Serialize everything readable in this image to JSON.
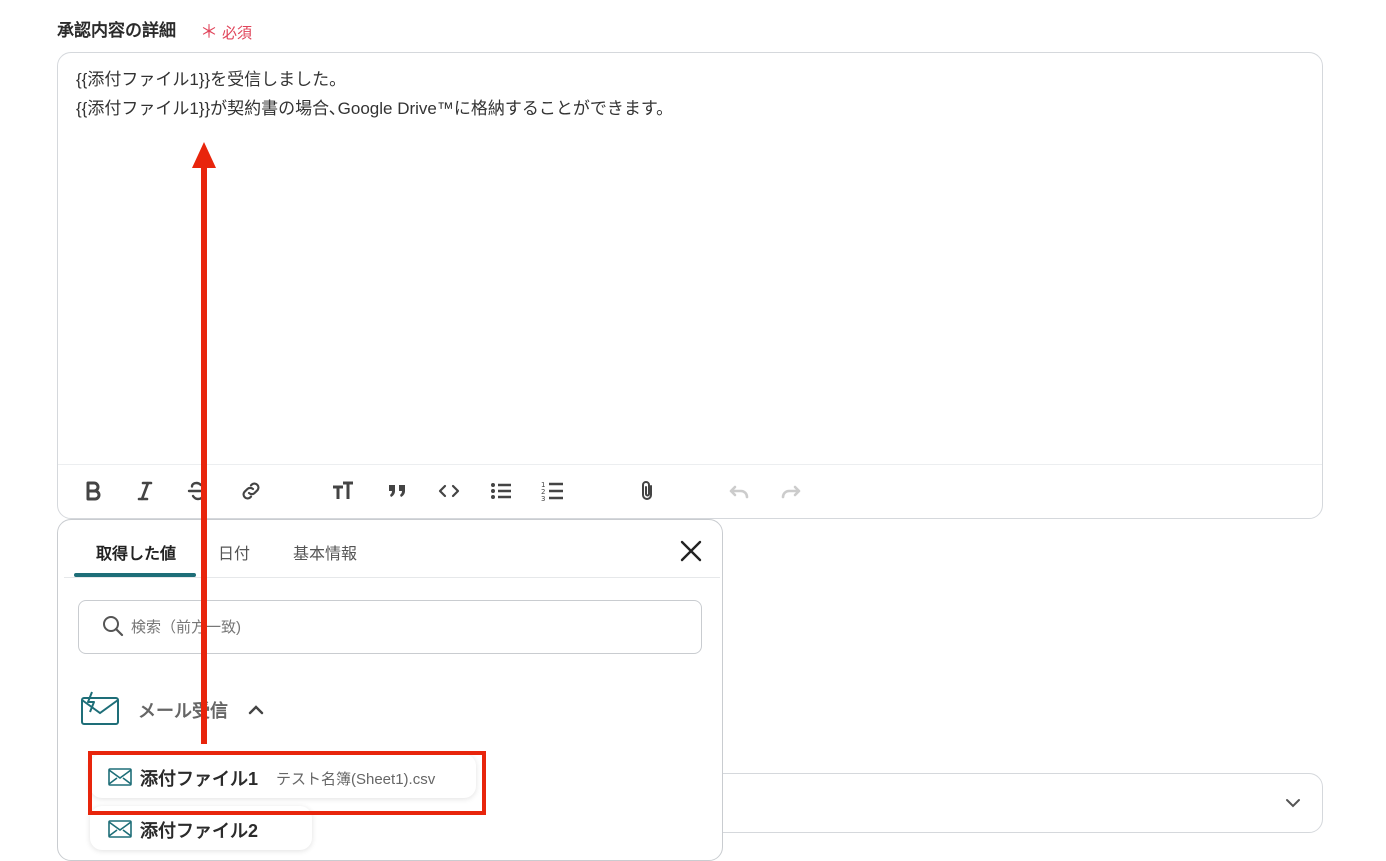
{
  "field": {
    "label": "承認内容の詳細",
    "required_marker": "＊",
    "required_text": "必須"
  },
  "editor": {
    "lines": [
      "{{添付ファイル1}}を受信しました。",
      "{{添付ファイル1}}が契約書の場合､Google Drive™に格納することができます。"
    ]
  },
  "toolbar": {
    "icons": [
      "bold-icon",
      "italic-icon",
      "strikethrough-icon",
      "link-icon",
      "text-size-icon",
      "quote-icon",
      "code-icon",
      "bullet-list-icon",
      "numbered-list-icon",
      "attachment-icon",
      "undo-icon",
      "redo-icon"
    ]
  },
  "popup": {
    "tabs": [
      {
        "label": "取得した値",
        "active": true
      },
      {
        "label": "日付",
        "active": false
      },
      {
        "label": "基本情報",
        "active": false
      }
    ],
    "search": {
      "placeholder": "検索（前方一致)"
    },
    "group": {
      "label": "メール受信",
      "icon": "mail-receive-icon",
      "expanded": true
    },
    "items": [
      {
        "name": "添付ファイル1",
        "value": "テスト名簿(Sheet1).csv",
        "icon": "mail-icon"
      },
      {
        "name": "添付ファイル2",
        "value": "",
        "icon": "mail-icon"
      }
    ]
  },
  "colors": {
    "accent": "#1e6e78",
    "required": "#e0455b",
    "highlight": "#e8250c"
  }
}
